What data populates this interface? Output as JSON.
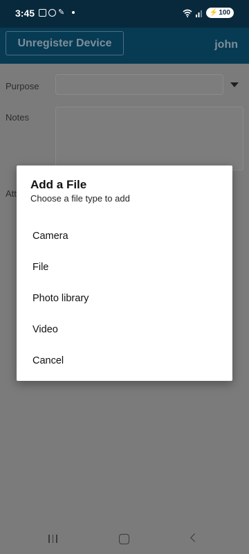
{
  "status_bar": {
    "time": "3:45",
    "battery": "100"
  },
  "header": {
    "unregister_label": "Unregister Device",
    "username": "john"
  },
  "form": {
    "purpose_label": "Purpose",
    "notes_label": "Notes",
    "attachments_label": "Att"
  },
  "dialog": {
    "title": "Add a File",
    "subtitle": "Choose a file type to add",
    "options": [
      {
        "label": "Camera"
      },
      {
        "label": "File"
      },
      {
        "label": "Photo library"
      },
      {
        "label": "Video"
      },
      {
        "label": "Cancel"
      }
    ]
  },
  "colors": {
    "status_bar_bg": "#08293c",
    "header_bg": "#073a53",
    "scrim": "#7b7b7b",
    "dialog_bg": "#ffffff"
  }
}
